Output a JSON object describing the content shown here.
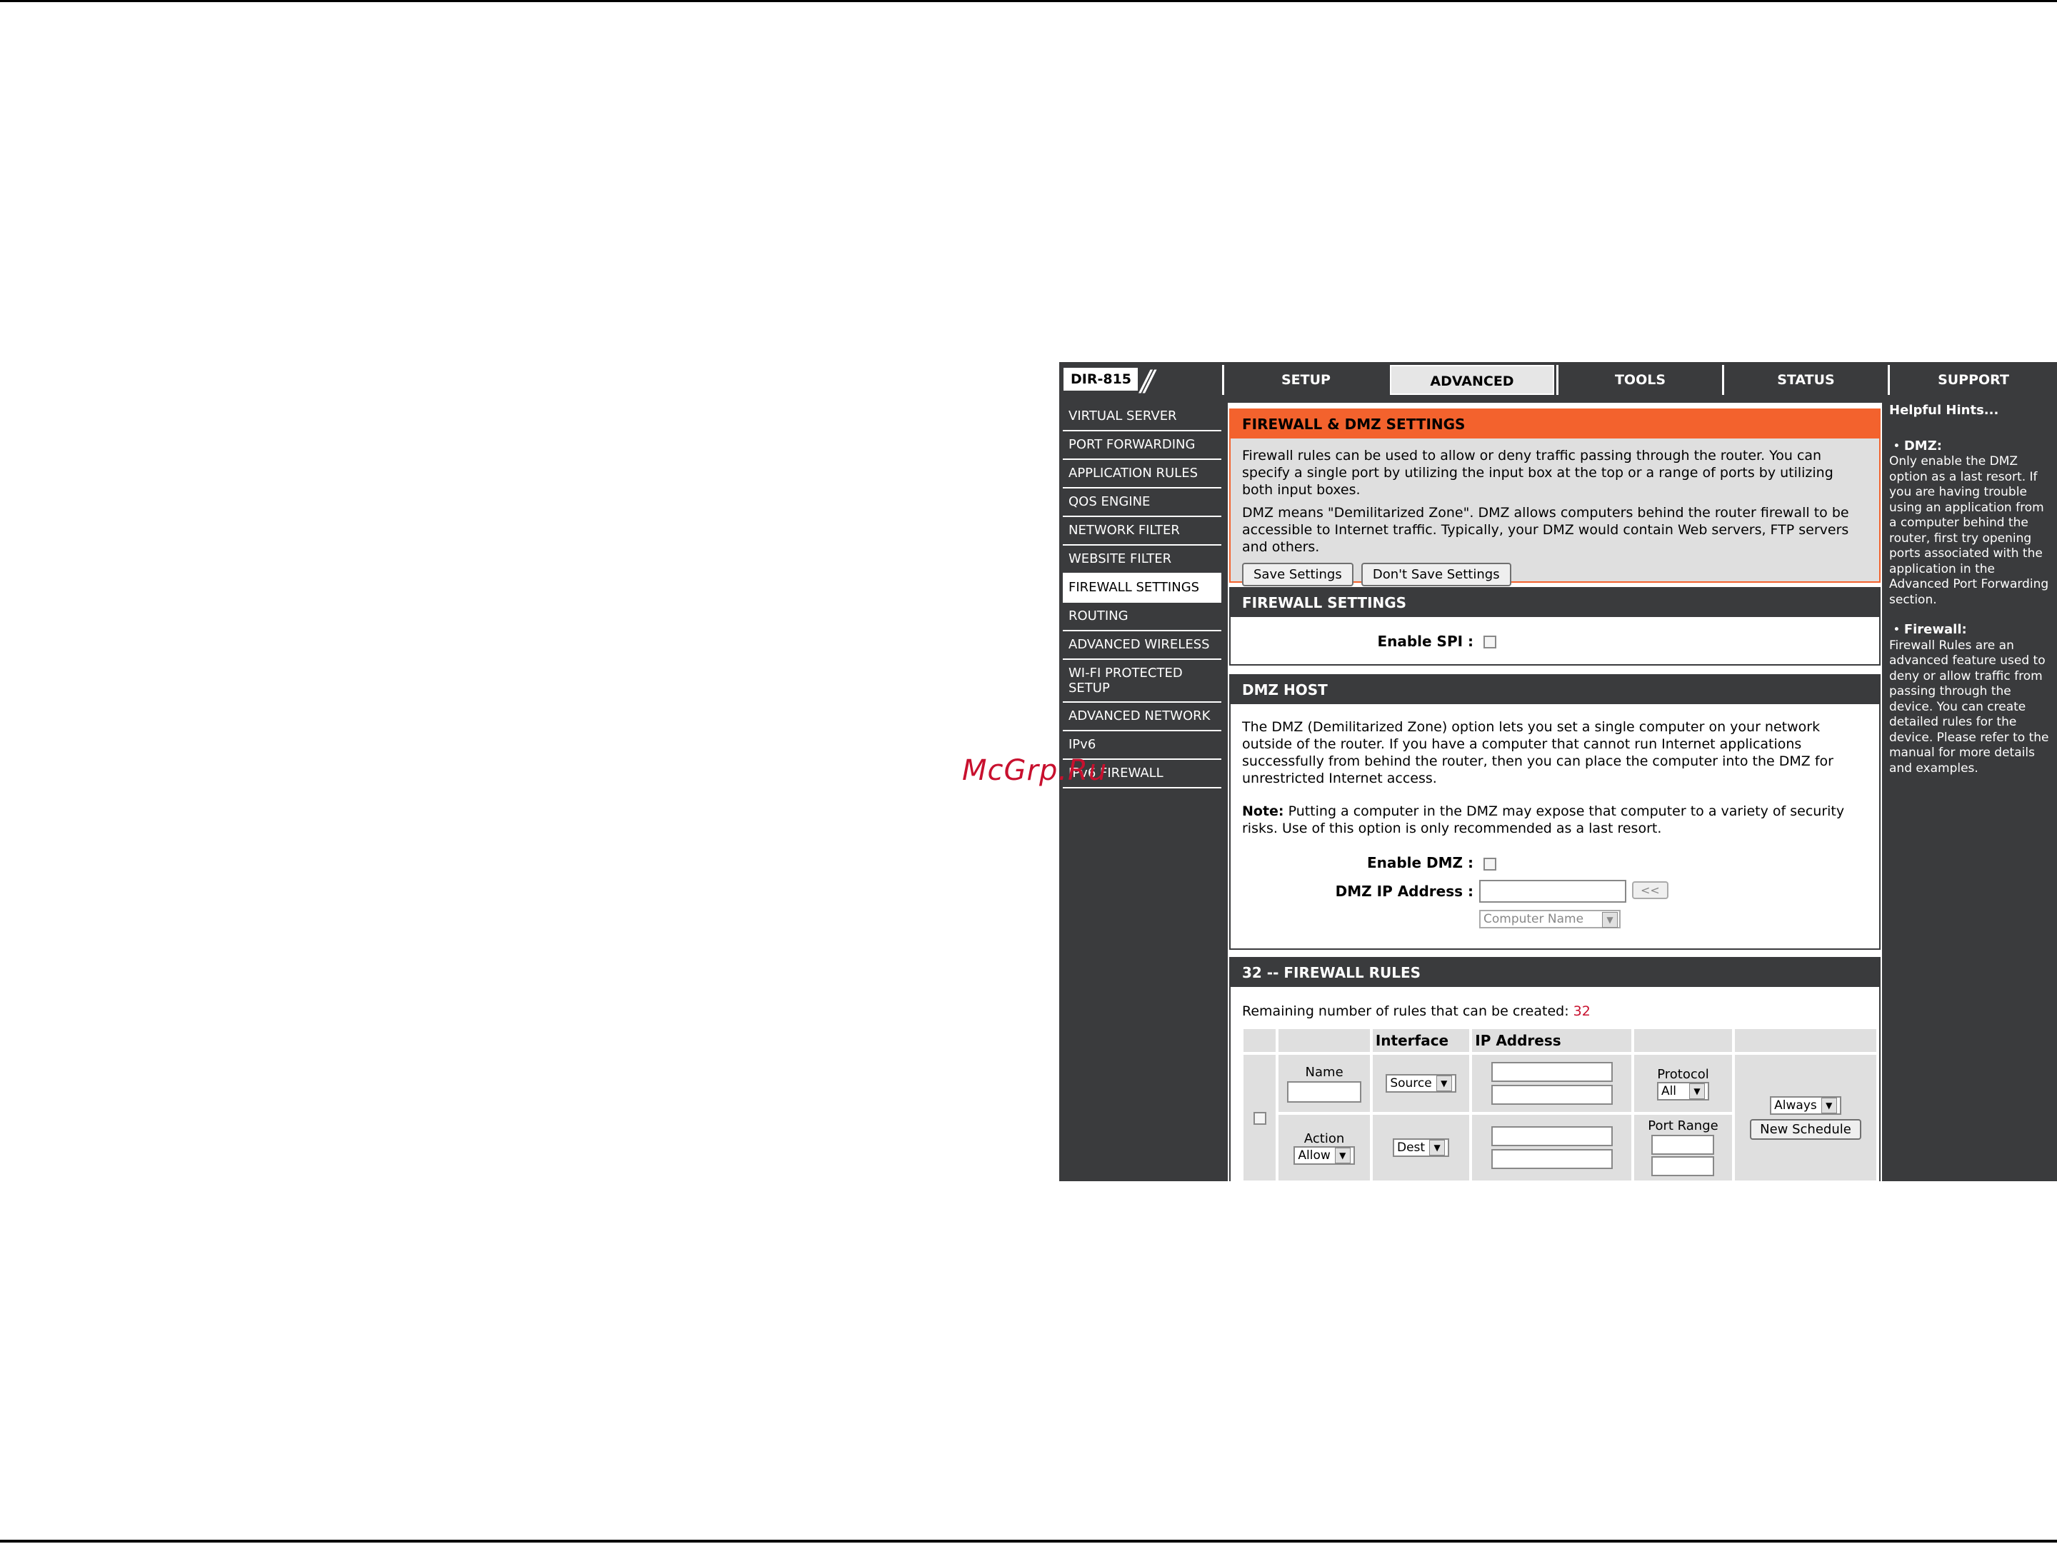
{
  "watermark": "McGrp.Ru",
  "header": {
    "model": "DIR-815",
    "slashes": "//",
    "tabs": [
      "SETUP",
      "ADVANCED",
      "TOOLS",
      "STATUS",
      "SUPPORT"
    ],
    "active_tab": "ADVANCED"
  },
  "sidebar": {
    "items": [
      "VIRTUAL SERVER",
      "PORT FORWARDING",
      "APPLICATION RULES",
      "QOS ENGINE",
      "NETWORK FILTER",
      "WEBSITE FILTER",
      "FIREWALL SETTINGS",
      "ROUTING",
      "ADVANCED WIRELESS",
      "WI-FI PROTECTED SETUP",
      "ADVANCED NETWORK",
      "IPv6",
      "IPv6 FIREWALL"
    ],
    "active_item": "FIREWALL SETTINGS"
  },
  "intro": {
    "title": "FIREWALL & DMZ SETTINGS",
    "para1": "Firewall rules can be used to allow or deny traffic passing through the router. You can specify a single port by utilizing the input box at the top or a range of ports by utilizing both input boxes.",
    "para2": "DMZ means \"Demilitarized Zone\". DMZ allows computers behind the router firewall to be accessible to Internet traffic. Typically, your DMZ would contain Web servers, FTP servers and others.",
    "save_label": "Save Settings",
    "dont_save_label": "Don't Save Settings"
  },
  "firewall": {
    "title": "FIREWALL SETTINGS",
    "spi_label": "Enable SPI :"
  },
  "dmz": {
    "title": "DMZ HOST",
    "para": "The DMZ (Demilitarized Zone) option lets you set a single computer on your network outside of the router. If you have a computer that cannot run Internet applications successfully from behind the router, then you can place the computer into the DMZ for unrestricted Internet access.",
    "note_label": "Note:",
    "note_text": " Putting a computer in the DMZ may expose that computer to a variety of security risks. Use of this option is only recommended as a last resort.",
    "enable_label": "Enable DMZ :",
    "ip_label": "DMZ IP Address :",
    "copy_button": "<<",
    "computer_name_placeholder": "Computer Name"
  },
  "rules": {
    "title": "32 -- FIREWALL RULES",
    "remaining_label": "Remaining number of rules that can be created: ",
    "remaining_value": "32",
    "header_interface": "Interface",
    "header_ip": "IP Address",
    "name_label": "Name",
    "action_label": "Action",
    "action_value": "Allow",
    "source_value": "Source",
    "dest_value": "Dest",
    "protocol_label": "Protocol",
    "protocol_value": "All",
    "port_range_label": "Port Range",
    "schedule_value": "Always",
    "new_schedule_label": "New Schedule"
  },
  "hints": {
    "title": "Helpful Hints...",
    "dmz_head": "DMZ:",
    "dmz_text": "Only enable the DMZ option as a last resort. If you are having trouble using an application from a computer behind the router, first try opening ports associated with the application in the Advanced Port Forwarding section.",
    "firewall_head": "Firewall:",
    "firewall_text": "Firewall Rules are an advanced feature used to deny or allow traffic from passing through the device. You can create detailed rules for the device. Please refer to the manual for more details and examples."
  }
}
